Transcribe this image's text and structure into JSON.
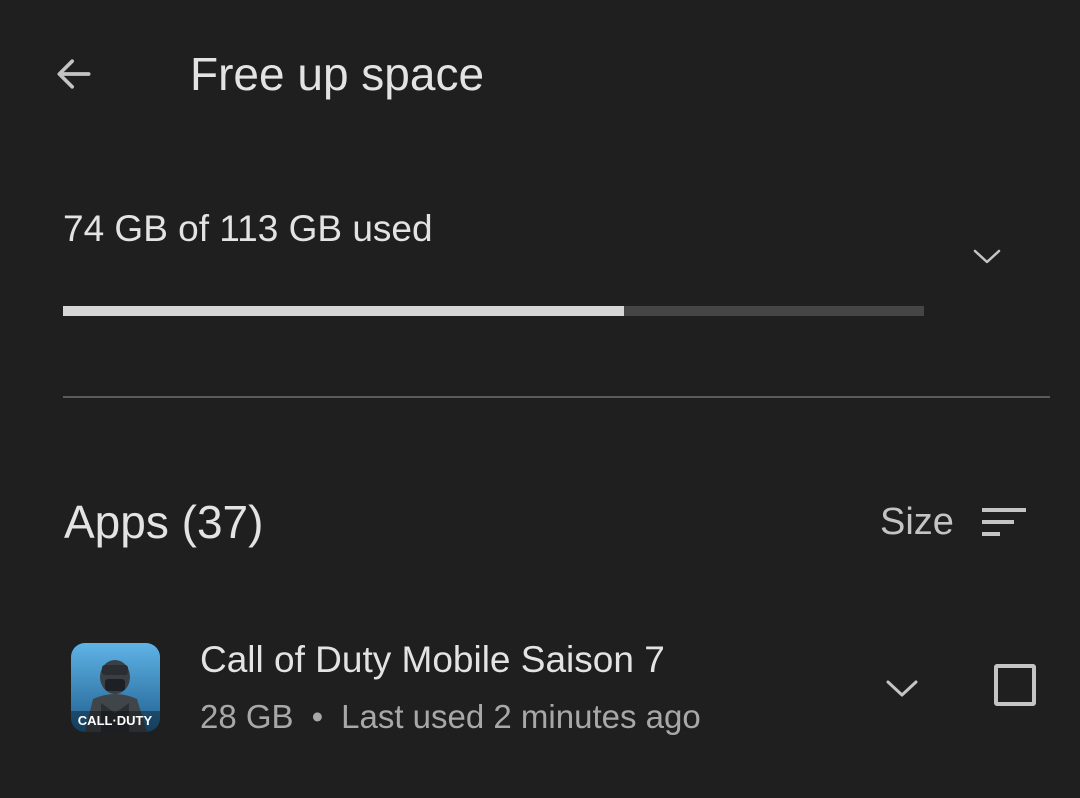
{
  "header": {
    "title": "Free up space",
    "back_icon": "arrow-left-icon"
  },
  "storage": {
    "summary": "74 GB of 113 GB used",
    "used_fraction": 0.651,
    "expand_icon": "chevron-down-icon"
  },
  "apps_section": {
    "heading": "Apps (37)",
    "sort_label": "Size",
    "sort_icon": "sort-icon"
  },
  "apps": [
    {
      "name": "Call of Duty Mobile Saison 7",
      "size": "28 GB",
      "separator": "•",
      "last_used": "Last used 2 minutes ago",
      "icon_text": "CALL·DUTY",
      "expand_icon": "chevron-down-icon",
      "checked": false
    }
  ],
  "colors": {
    "background": "#1f1f1f",
    "progress_fill": "#d6d6d6",
    "progress_track": "#454545"
  }
}
